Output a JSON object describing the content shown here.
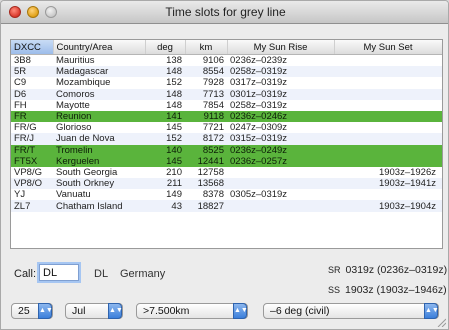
{
  "window": {
    "title": "Time slots for grey line"
  },
  "table": {
    "headers": {
      "dxcc": "DXCC",
      "country": "Country/Area",
      "deg": "deg",
      "km": "km",
      "sunrise": "My Sun Rise",
      "sunset": "My Sun Set"
    },
    "rows": [
      {
        "dxcc": "3B8",
        "country": "Mauritius",
        "deg": "138",
        "km": "9106",
        "sunrise": "0236z–0239z",
        "sunset": "",
        "highlight": false
      },
      {
        "dxcc": "5R",
        "country": "Madagascar",
        "deg": "148",
        "km": "8554",
        "sunrise": "0258z–0319z",
        "sunset": "",
        "highlight": false
      },
      {
        "dxcc": "C9",
        "country": "Mozambique",
        "deg": "152",
        "km": "7928",
        "sunrise": "0317z–0319z",
        "sunset": "",
        "highlight": false
      },
      {
        "dxcc": "D6",
        "country": "Comoros",
        "deg": "148",
        "km": "7713",
        "sunrise": "0301z–0319z",
        "sunset": "",
        "highlight": false
      },
      {
        "dxcc": "FH",
        "country": "Mayotte",
        "deg": "148",
        "km": "7854",
        "sunrise": "0258z–0319z",
        "sunset": "",
        "highlight": false
      },
      {
        "dxcc": "FR",
        "country": "Reunion",
        "deg": "141",
        "km": "9118",
        "sunrise": "0236z–0246z",
        "sunset": "",
        "highlight": true
      },
      {
        "dxcc": "FR/G",
        "country": "Glorioso",
        "deg": "145",
        "km": "7721",
        "sunrise": "0247z–0309z",
        "sunset": "",
        "highlight": false
      },
      {
        "dxcc": "FR/J",
        "country": "Juan de Nova",
        "deg": "152",
        "km": "8172",
        "sunrise": "0315z–0319z",
        "sunset": "",
        "highlight": false
      },
      {
        "dxcc": "FR/T",
        "country": "Tromelin",
        "deg": "140",
        "km": "8525",
        "sunrise": "0236z–0249z",
        "sunset": "",
        "highlight": true
      },
      {
        "dxcc": "FT5X",
        "country": "Kerguelen",
        "deg": "145",
        "km": "12441",
        "sunrise": "0236z–0257z",
        "sunset": "",
        "highlight": true
      },
      {
        "dxcc": "VP8/G",
        "country": "South Georgia",
        "deg": "210",
        "km": "12758",
        "sunrise": "",
        "sunset": "1903z–1926z",
        "highlight": false
      },
      {
        "dxcc": "VP8/O",
        "country": "South Orkney",
        "deg": "211",
        "km": "13568",
        "sunrise": "",
        "sunset": "1903z–1941z",
        "highlight": false
      },
      {
        "dxcc": "YJ",
        "country": "Vanuatu",
        "deg": "149",
        "km": "8378",
        "sunrise": "0305z–0319z",
        "sunset": "",
        "highlight": false
      },
      {
        "dxcc": "ZL7",
        "country": "Chatham Island",
        "deg": "43",
        "km": "18827",
        "sunrise": "",
        "sunset": "1903z–1904z",
        "highlight": false
      }
    ]
  },
  "form": {
    "call_label": "Call:",
    "call_value": "DL",
    "country_code": "DL",
    "country_name": "Germany",
    "sunrise_label": "SR",
    "sunrise_text": "0319z (0236z–0319z)",
    "sunset_label": "SS",
    "sunset_text": "1903z (1903z–1946z)"
  },
  "selects": {
    "day": "25",
    "month": "Jul",
    "distance": ">7.500km",
    "twilight": "–6 deg (civil)"
  },
  "colors": {
    "highlight_row": "#5ab43c",
    "alt_row": "#eef2fb",
    "sorted_header": "#9cbcea"
  }
}
